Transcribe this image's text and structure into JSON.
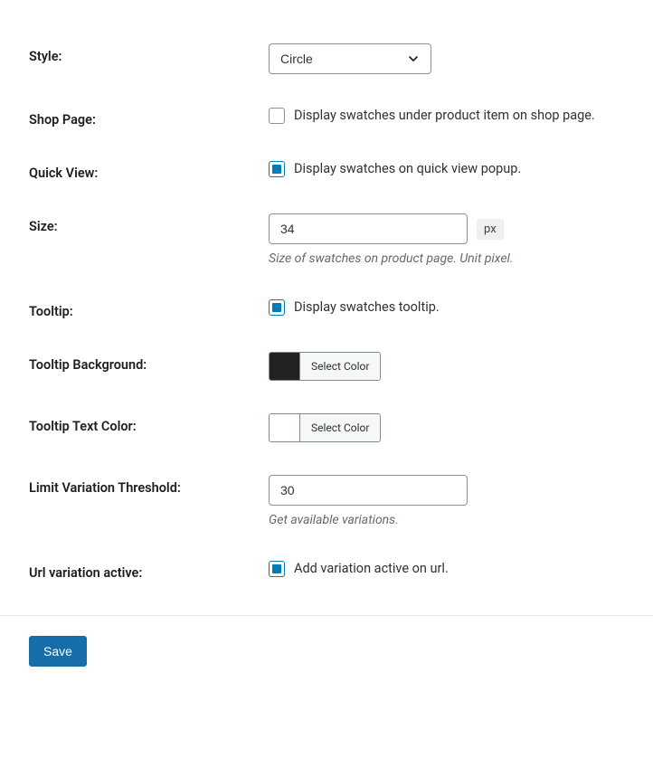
{
  "fields": {
    "style": {
      "label": "Style:",
      "value": "Circle"
    },
    "shopPage": {
      "label": "Shop Page:",
      "checkboxLabel": "Display swatches under product item on shop page."
    },
    "quickView": {
      "label": "Quick View:",
      "checkboxLabel": "Display swatches on quick view popup."
    },
    "size": {
      "label": "Size:",
      "value": "34",
      "unit": "px",
      "description": "Size of swatches on product page. Unit pixel."
    },
    "tooltip": {
      "label": "Tooltip:",
      "checkboxLabel": "Display swatches tooltip."
    },
    "tooltipBg": {
      "label": "Tooltip Background:",
      "buttonLabel": "Select Color"
    },
    "tooltipTextColor": {
      "label": "Tooltip Text Color:",
      "buttonLabel": "Select Color"
    },
    "limitThreshold": {
      "label": "Limit Variation Threshold:",
      "value": "30",
      "description": "Get available variations."
    },
    "urlVariation": {
      "label": "Url variation active:",
      "checkboxLabel": "Add variation active on url."
    }
  },
  "saveButton": "Save"
}
